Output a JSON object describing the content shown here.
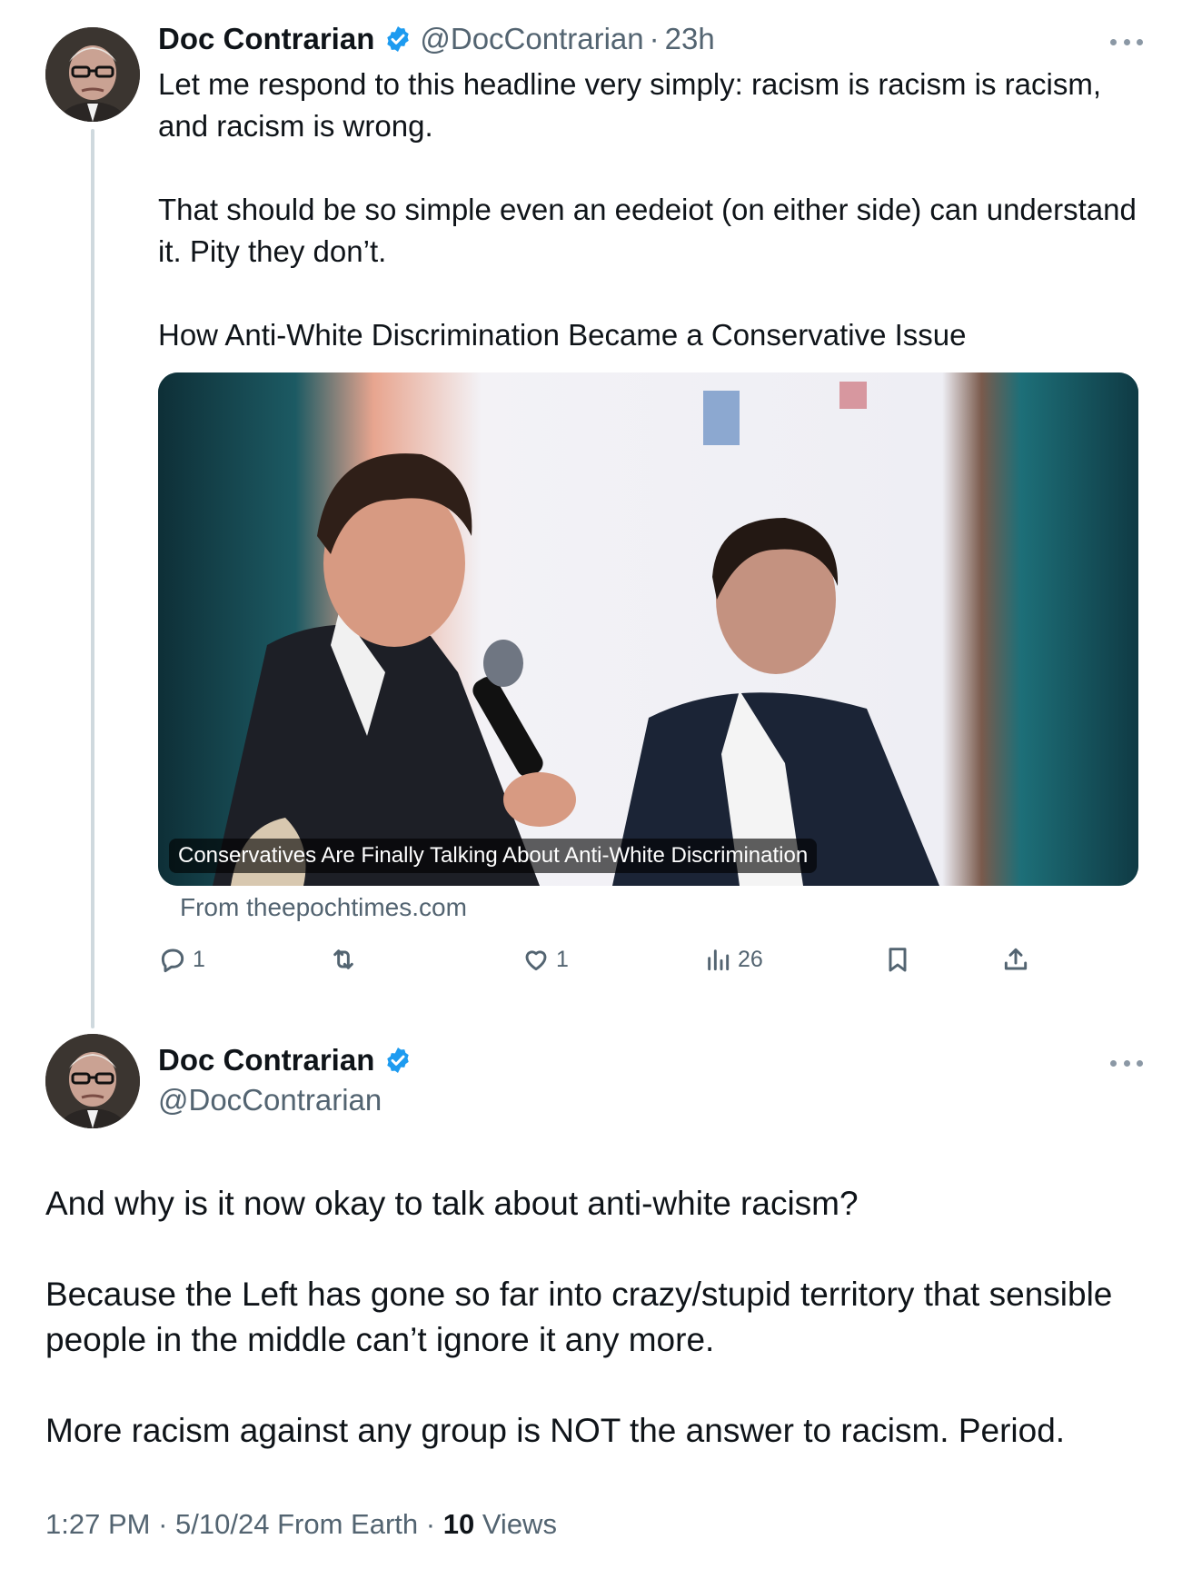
{
  "tweet1": {
    "author_name": "Doc Contrarian",
    "handle": "@DocContrarian",
    "separator": "·",
    "time": "23h",
    "text_lines": [
      "Let me respond to this headline very simply: racism is racism is racism, and racism is wrong.",
      "That should be so simple even an eedeiot (on either side) can understand it. Pity they don’t.",
      "How Anti-White Discrimination Became a Conservative Issue"
    ],
    "card": {
      "caption": "Conservatives Are Finally Talking About Anti-White Discrimination",
      "source": "From theepochtimes.com"
    },
    "actions": {
      "replies": "1",
      "reposts": "",
      "likes": "1",
      "views": "26"
    }
  },
  "tweet2": {
    "author_name": "Doc Contrarian",
    "handle": "@DocContrarian",
    "paragraphs": [
      "And why is it now okay to talk about anti-white racism?",
      "Because the Left has gone so far into crazy/stupid territory that sensible people in the middle can’t ignore it any more.",
      "More racism against any group is NOT the answer to racism. Period."
    ],
    "meta": {
      "time": "1:27 PM",
      "sep1": "·",
      "date": "5/10/24",
      "location": "From Earth",
      "sep2": "·",
      "views_count": "10",
      "views_label": "Views"
    }
  },
  "colors": {
    "verified_blue": "#1d9bf0",
    "text_primary": "#0f1419",
    "text_secondary": "#536471",
    "thread_line": "#cfd9de"
  },
  "icons": {
    "verified": "verified-badge-icon",
    "more": "more-options-icon",
    "reply": "reply-icon",
    "repost": "repost-icon",
    "like": "heart-icon",
    "views": "views-chart-icon",
    "bookmark": "bookmark-icon",
    "share": "share-icon"
  }
}
